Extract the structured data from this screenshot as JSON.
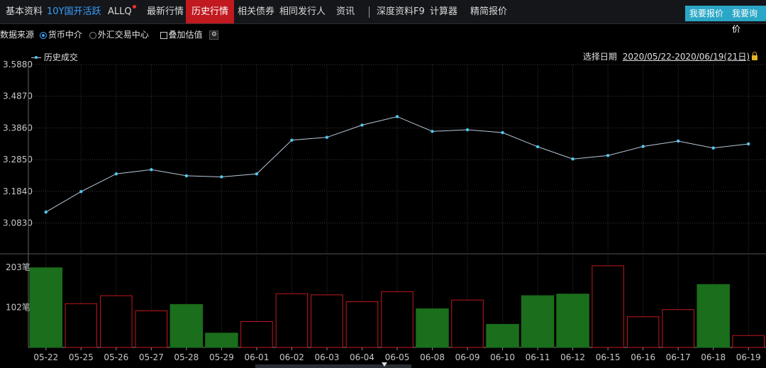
{
  "topbar": {
    "tabs": [
      {
        "label": "基本资料",
        "left": 8
      },
      {
        "label": "10Y国开活跃",
        "left": 66
      },
      {
        "label": "ALLQ",
        "left": 152
      },
      {
        "label": "最新行情",
        "left": 207
      },
      {
        "label": "历史行情",
        "left": 262
      },
      {
        "label": "相关债券",
        "left": 335
      },
      {
        "label": "相同发行人",
        "left": 394
      },
      {
        "label": "资讯",
        "left": 474
      },
      {
        "label": "深度资料F9",
        "left": 531
      },
      {
        "label": "计算器",
        "left": 606
      },
      {
        "label": "精简报价",
        "left": 663
      }
    ],
    "buttons": {
      "quote_label": "我要报价",
      "inquiry_label": "我要询价"
    }
  },
  "options": {
    "source_label": "数据来源",
    "option_a": "货币中介",
    "option_b": "外汇交易中心",
    "overlay_label": "叠加估值"
  },
  "legend": {
    "series_label": "历史成交"
  },
  "date_select": {
    "label": "选择日期",
    "value": "2020/05/22-2020/06/19(21日)"
  },
  "chart_data": [
    {
      "type": "line",
      "name": "历史成交",
      "x": [
        "05-22",
        "05-25",
        "05-26",
        "05-27",
        "05-28",
        "05-29",
        "06-01",
        "06-02",
        "06-03",
        "06-04",
        "06-05",
        "06-08",
        "06-09",
        "06-10",
        "06-11",
        "06-12",
        "06-15",
        "06-16",
        "06-17",
        "06-18",
        "06-19"
      ],
      "values": [
        3.118,
        3.183,
        3.2395,
        3.253,
        3.2335,
        3.23,
        3.2395,
        3.347,
        3.356,
        3.395,
        3.422,
        3.375,
        3.38,
        3.371,
        3.326,
        3.287,
        3.298,
        3.327,
        3.344,
        3.322,
        3.335
      ],
      "ytick_labels": [
        "3.5880",
        "3.4870",
        "3.3860",
        "3.2850",
        "3.1840",
        "3.0830"
      ],
      "ylim": [
        3.083,
        3.588
      ],
      "color": "#b8c8d8",
      "marker_color": "#4ec8f0",
      "grid": true
    },
    {
      "type": "bar",
      "unit": "笔",
      "x": [
        "05-22",
        "05-25",
        "05-26",
        "05-27",
        "05-28",
        "05-29",
        "06-01",
        "06-02",
        "06-03",
        "06-04",
        "06-05",
        "06-08",
        "06-09",
        "06-10",
        "06-11",
        "06-12",
        "06-15",
        "06-16",
        "06-17",
        "06-18",
        "06-19"
      ],
      "values": [
        200,
        110,
        130,
        92,
        108,
        36,
        65,
        135,
        132,
        115,
        140,
        97,
        119,
        58,
        130,
        134,
        205,
        77,
        95,
        158,
        30
      ],
      "direction": [
        "up",
        "down",
        "down",
        "down",
        "up",
        "up",
        "down",
        "down",
        "down",
        "down",
        "down",
        "up",
        "down",
        "up",
        "up",
        "up",
        "down",
        "down",
        "down",
        "up",
        "down"
      ],
      "ytick_labels": [
        "203笔",
        "102笔"
      ],
      "ylim": [
        0,
        203
      ],
      "up_color": "#1b6e1b",
      "down_color": "#c0191f"
    }
  ]
}
